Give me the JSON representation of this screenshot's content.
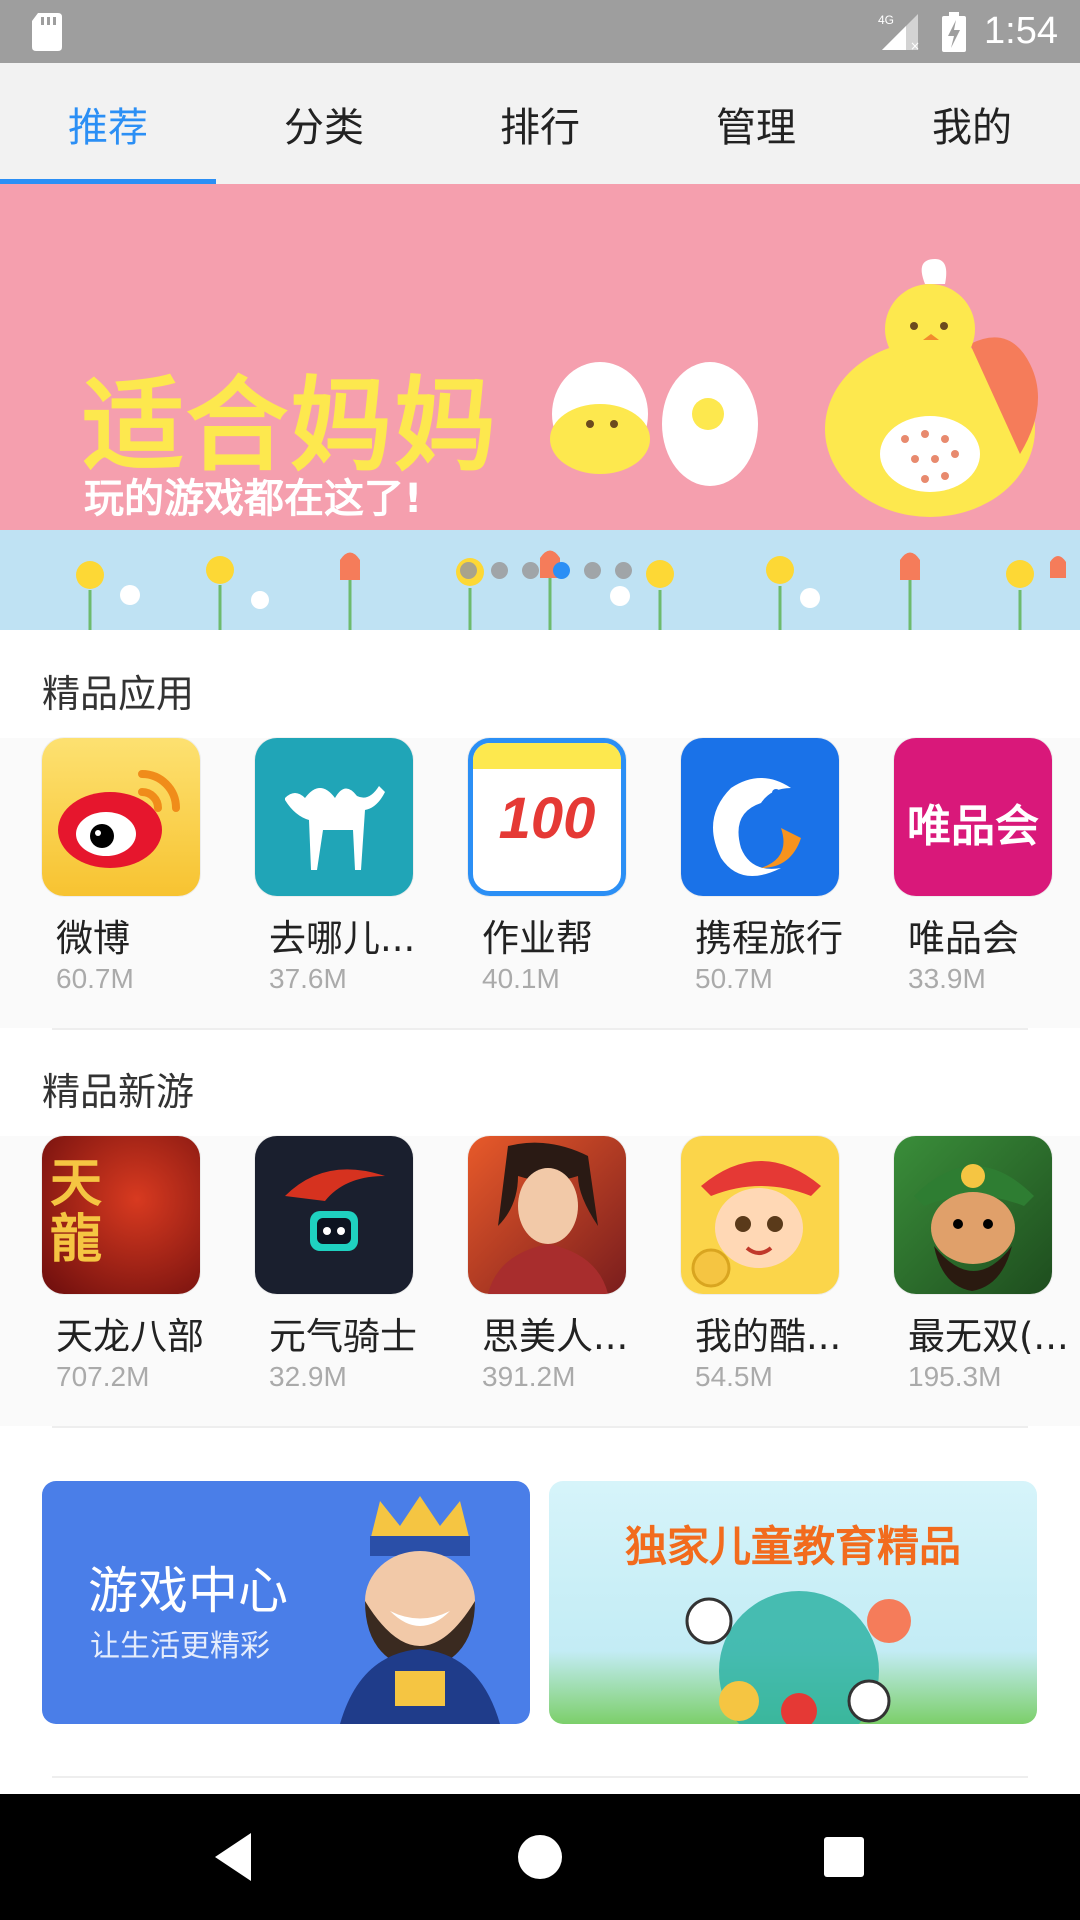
{
  "status_bar": {
    "network": "4G",
    "time": "1:54"
  },
  "tabs": [
    {
      "label": "推荐",
      "active": true
    },
    {
      "label": "分类",
      "active": false
    },
    {
      "label": "排行",
      "active": false
    },
    {
      "label": "管理",
      "active": false
    },
    {
      "label": "我的",
      "active": false
    }
  ],
  "banner": {
    "title": "适合妈妈",
    "subtitle": "玩的游戏都在这了!",
    "page_count": 6,
    "active_page": 4
  },
  "featured_apps": {
    "title": "精品应用",
    "items": [
      {
        "name": "微博",
        "size": "60.7M",
        "icon": "weibo-icon"
      },
      {
        "name": "去哪儿...",
        "size": "37.6M",
        "icon": "qunar-icon"
      },
      {
        "name": "作业帮",
        "size": "40.1M",
        "icon": "zuoyebang-icon"
      },
      {
        "name": "携程旅行",
        "size": "50.7M",
        "icon": "ctrip-icon"
      },
      {
        "name": "唯品会",
        "size": "33.9M",
        "icon": "vipshop-icon"
      }
    ]
  },
  "featured_games": {
    "title": "精品新游",
    "items": [
      {
        "name": "天龙八部",
        "size": "707.2M",
        "icon": "tianlong-icon"
      },
      {
        "name": "元气骑士",
        "size": "32.9M",
        "icon": "soul-knight-icon"
      },
      {
        "name": "思美人...",
        "size": "391.2M",
        "icon": "simeiren-icon"
      },
      {
        "name": "我的酷...",
        "size": "54.5M",
        "icon": "wodeku-icon"
      },
      {
        "name": "最无双(...",
        "size": "195.3M",
        "icon": "zuiwushuang-icon"
      }
    ]
  },
  "promos": {
    "game_center": {
      "title": "游戏中心",
      "subtitle": "让生活更精彩"
    },
    "kids": {
      "title": "独家儿童教育精品"
    }
  },
  "icon_labels": {
    "zuoyebang": "100",
    "vipshop": "唯品会",
    "tianlong": "天龍"
  },
  "colors": {
    "accent": "#2b8ff5",
    "status_bar": "#9e9e9e",
    "tab_bar": "#f2f2f2"
  }
}
